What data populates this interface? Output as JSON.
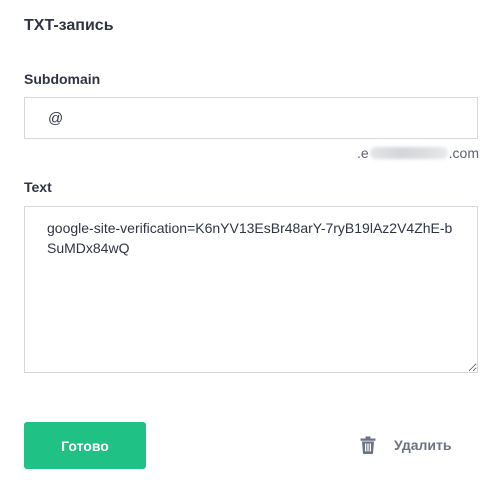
{
  "form": {
    "title": "TXT-запись",
    "subdomain": {
      "label": "Subdomain",
      "value": "@",
      "suffix_prefix": ".e",
      "suffix_end": ".com"
    },
    "text": {
      "label": "Text",
      "value": "google-site-verification=K6nYV13EsBr48arY-7ryB19lAz2V4ZhE-bSuMDx84wQ"
    },
    "buttons": {
      "done_label": "Готово",
      "delete_label": "Удалить",
      "delete_icon": "trash-icon"
    }
  },
  "colors": {
    "primary": "#1fc185",
    "text": "#2f3441",
    "muted": "#6b7280",
    "border": "#d5d8dd"
  }
}
